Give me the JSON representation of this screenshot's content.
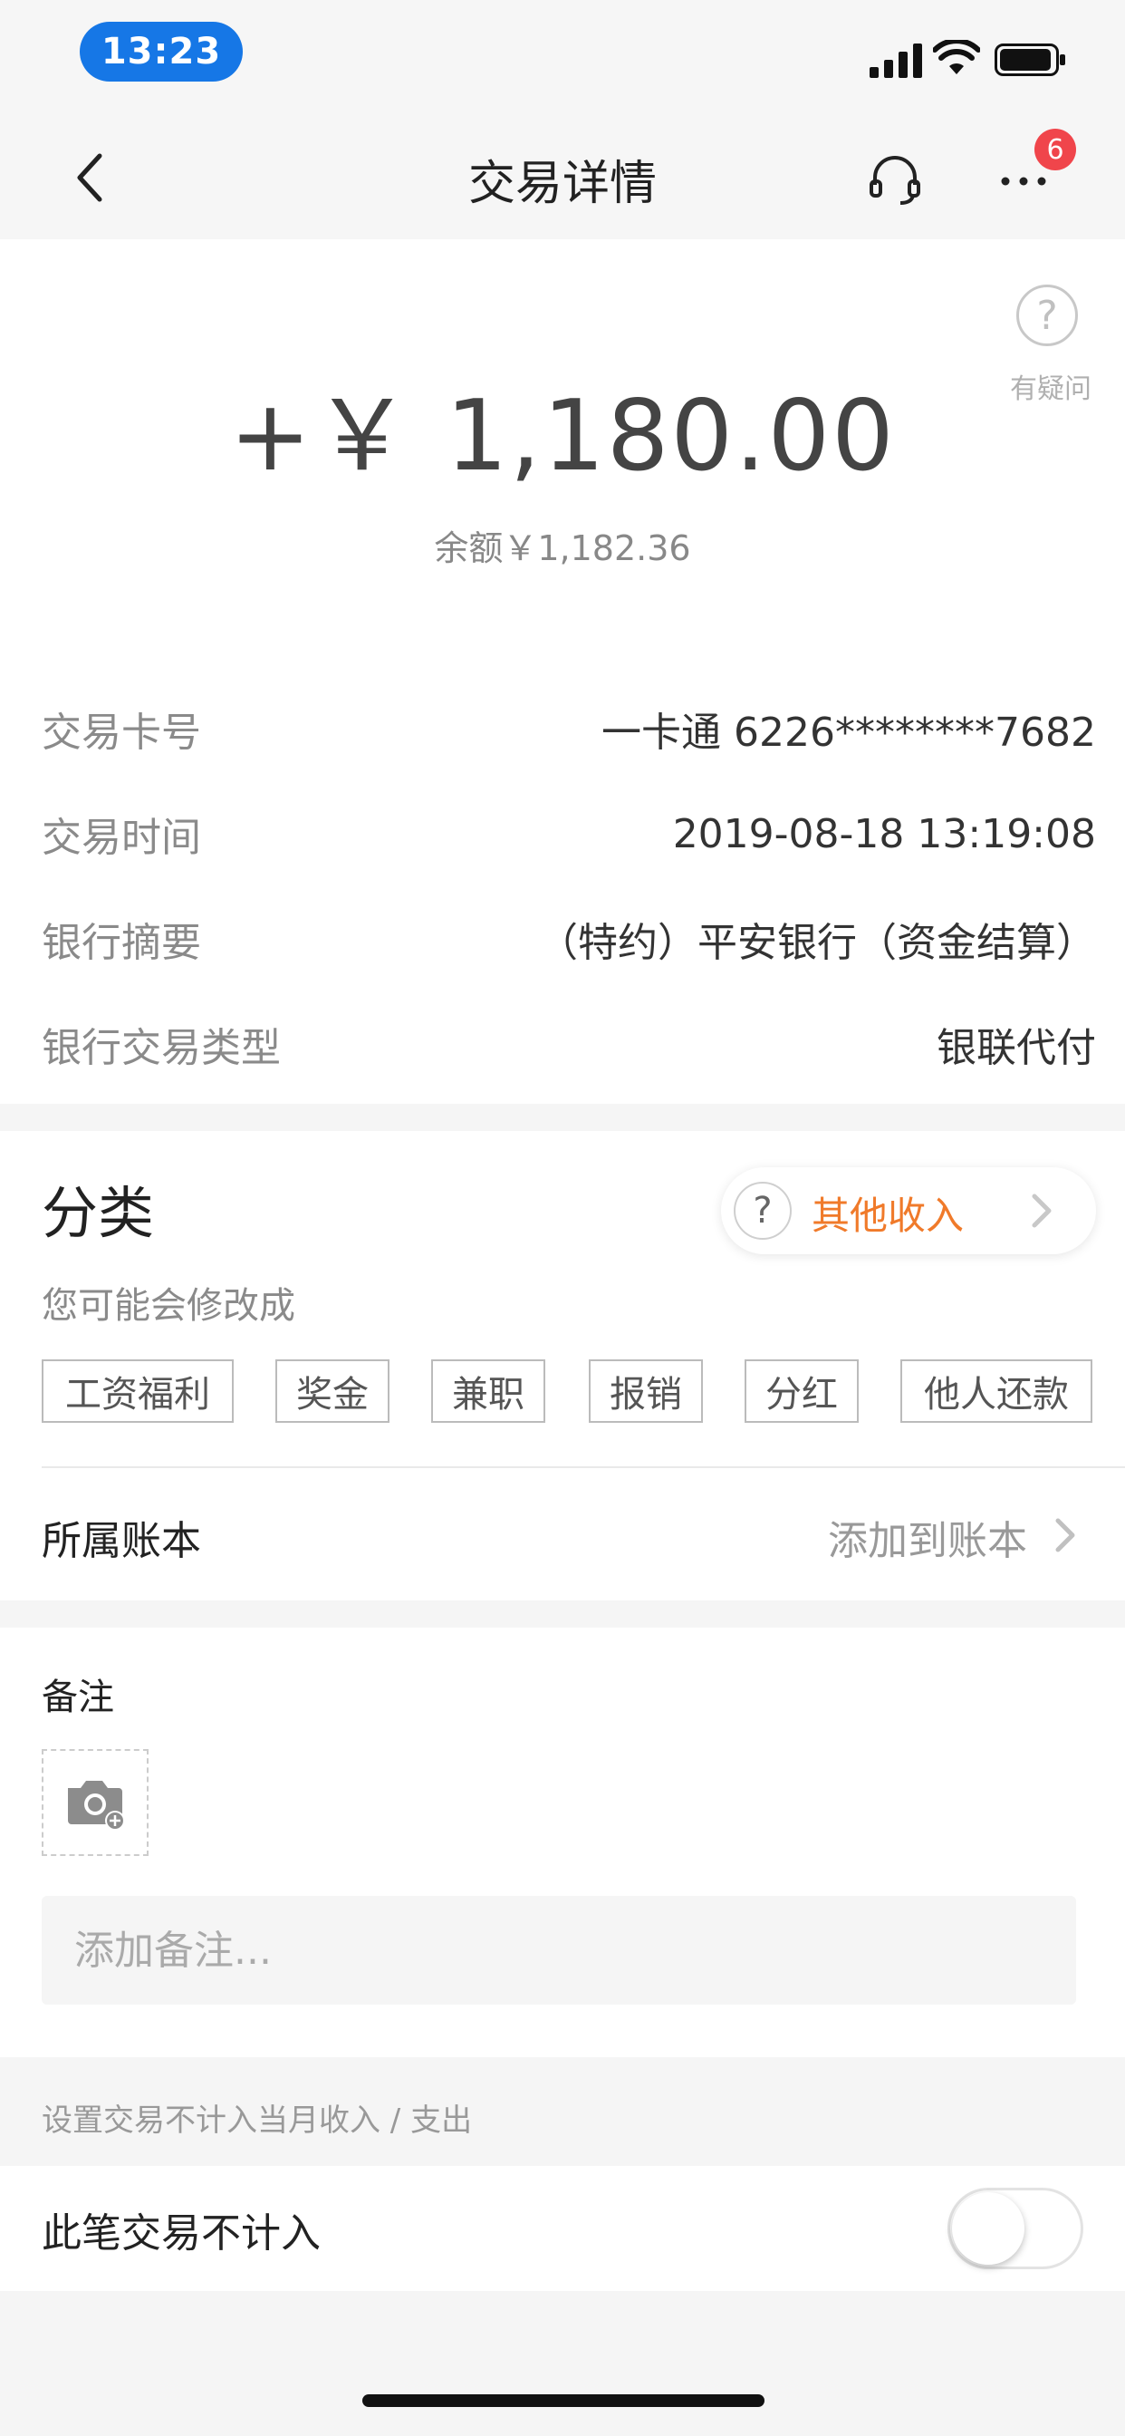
{
  "status_bar": {
    "time": "13:23"
  },
  "nav": {
    "title": "交易详情",
    "badge_count": "6"
  },
  "amount_card": {
    "help_label": "有疑问",
    "amount": "+￥ 1,180.00",
    "balance": "余额￥1,182.36"
  },
  "details": [
    {
      "label": "交易卡号",
      "value": "一卡通 6226********7682"
    },
    {
      "label": "交易时间",
      "value": "2019-08-18 13:19:08"
    },
    {
      "label": "银行摘要",
      "value": "（特约）平安银行（资金结算）"
    },
    {
      "label": "银行交易类型",
      "value": "银联代付"
    }
  ],
  "category": {
    "title": "分类",
    "current": "其他收入",
    "hint": "您可能会修改成",
    "tags": [
      "工资福利",
      "奖金",
      "兼职",
      "报销",
      "分红",
      "他人还款"
    ]
  },
  "ledger": {
    "label": "所属账本",
    "value": "添加到账本"
  },
  "notes": {
    "title": "备注",
    "placeholder": "添加备注..."
  },
  "exclude": {
    "section_hint": "设置交易不计入当月收入 / 支出",
    "label": "此笔交易不计入",
    "enabled": false
  },
  "colors": {
    "accent_orange": "#f07a2a",
    "time_pill": "#1677e6",
    "badge_red": "#f0454b"
  }
}
